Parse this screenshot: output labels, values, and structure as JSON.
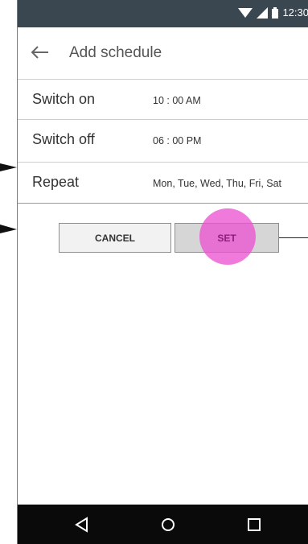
{
  "status": {
    "time": "12:30"
  },
  "appbar": {
    "title": "Add schedule",
    "back_icon": "back-arrow-icon"
  },
  "rows": [
    {
      "label": "Switch on",
      "value": "10 : 00  AM"
    },
    {
      "label": "Switch off",
      "value": "06 : 00  PM"
    },
    {
      "label": "Repeat",
      "value": "Mon, Tue, Wed, Thu, Fri, Sat"
    }
  ],
  "buttons": {
    "cancel": "CANCEL",
    "set": "SET"
  },
  "navbar": {
    "icons": [
      "back-triangle-icon",
      "home-circle-icon",
      "recents-square-icon"
    ]
  },
  "colors": {
    "statusbar": "#3a4650",
    "touch_indicator": "#ec54d2",
    "navbar": "#0a0a0a"
  }
}
